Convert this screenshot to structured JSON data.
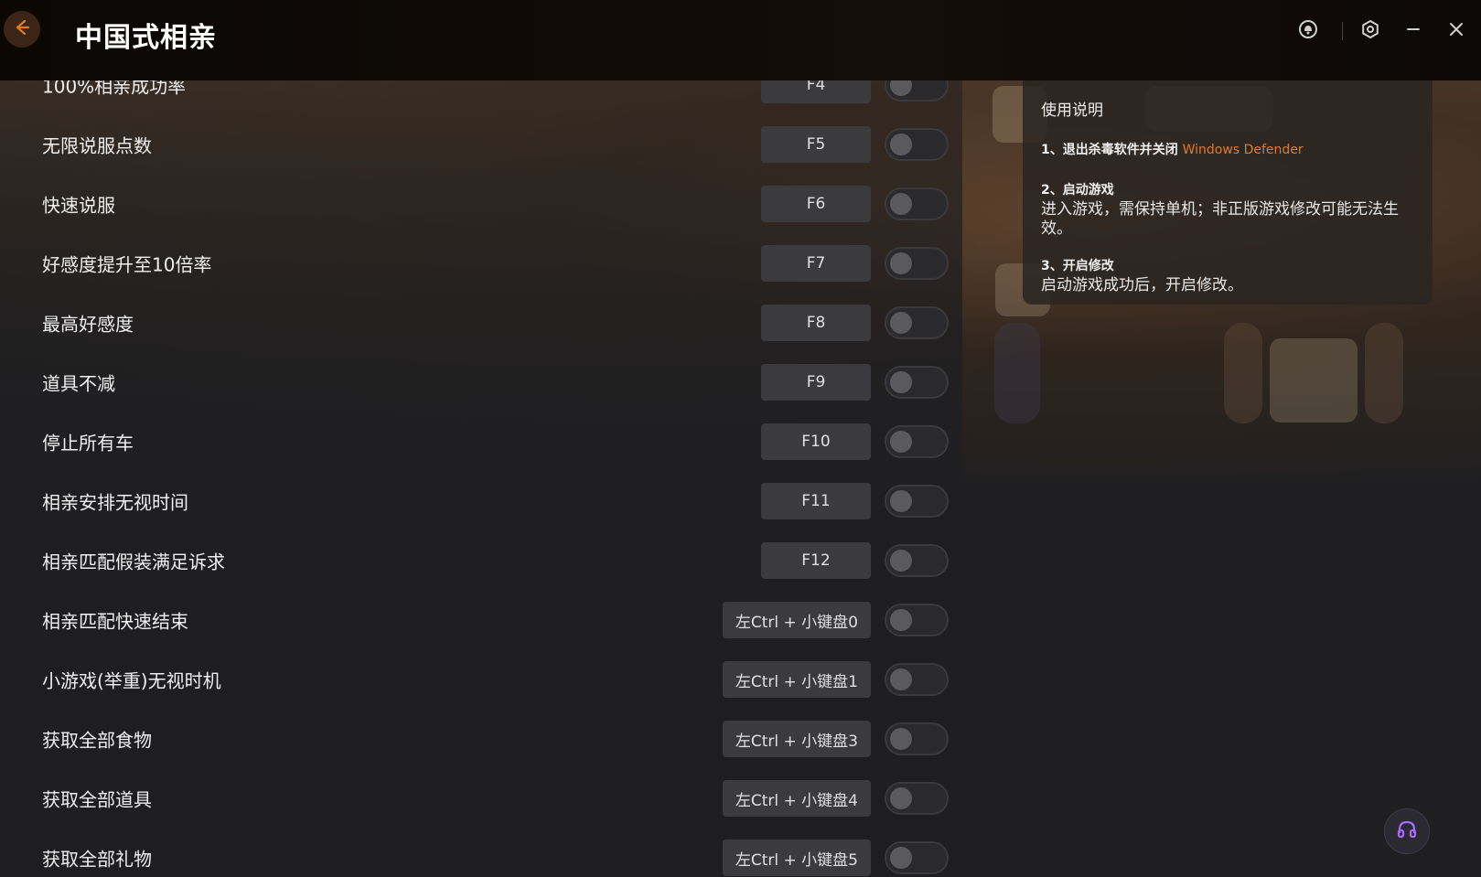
{
  "app": {
    "title": "中国式相亲"
  },
  "features": [
    {
      "label": "100%相亲成功率",
      "hotkey": "F4",
      "enabled": false
    },
    {
      "label": "无限说服点数",
      "hotkey": "F5",
      "enabled": false
    },
    {
      "label": "快速说服",
      "hotkey": "F6",
      "enabled": false
    },
    {
      "label": "好感度提升至10倍率",
      "hotkey": "F7",
      "enabled": false
    },
    {
      "label": "最高好感度",
      "hotkey": "F8",
      "enabled": false
    },
    {
      "label": "道具不减",
      "hotkey": "F9",
      "enabled": false
    },
    {
      "label": "停止所有车",
      "hotkey": "F10",
      "enabled": false
    },
    {
      "label": "相亲安排无视时间",
      "hotkey": "F11",
      "enabled": false
    },
    {
      "label": "相亲匹配假装满足诉求",
      "hotkey": "F12",
      "enabled": false
    },
    {
      "label": "相亲匹配快速结束",
      "hotkey": "左Ctrl + 小键盘0",
      "enabled": false
    },
    {
      "label": "小游戏(举重)无视时机",
      "hotkey": "左Ctrl + 小键盘1",
      "enabled": false
    },
    {
      "label": "获取全部食物",
      "hotkey": "左Ctrl + 小键盘3",
      "enabled": false
    },
    {
      "label": "获取全部道具",
      "hotkey": "左Ctrl + 小键盘4",
      "enabled": false
    },
    {
      "label": "获取全部礼物",
      "hotkey": "左Ctrl + 小键盘5",
      "enabled": false
    }
  ],
  "instructions": {
    "title": "使用说明",
    "step1_head": "1、退出杀毒软件并关闭",
    "step1_accent": "Windows Defender",
    "step2_head": "2、启动游戏",
    "step2_body": "进入游戏，需保持单机；非正版游戏修改可能无法生效。",
    "step3_head": "3、开启修改",
    "step3_body": "启动游戏成功后，开启修改。"
  },
  "colors": {
    "accent": "#e07a28",
    "support_icon": "#a56bff"
  },
  "icons": {
    "back": "arrow-left-icon",
    "notify": "bell-icon",
    "settings": "gear-icon",
    "minimize": "minimize-icon",
    "close": "close-icon",
    "support": "headset-icon"
  }
}
